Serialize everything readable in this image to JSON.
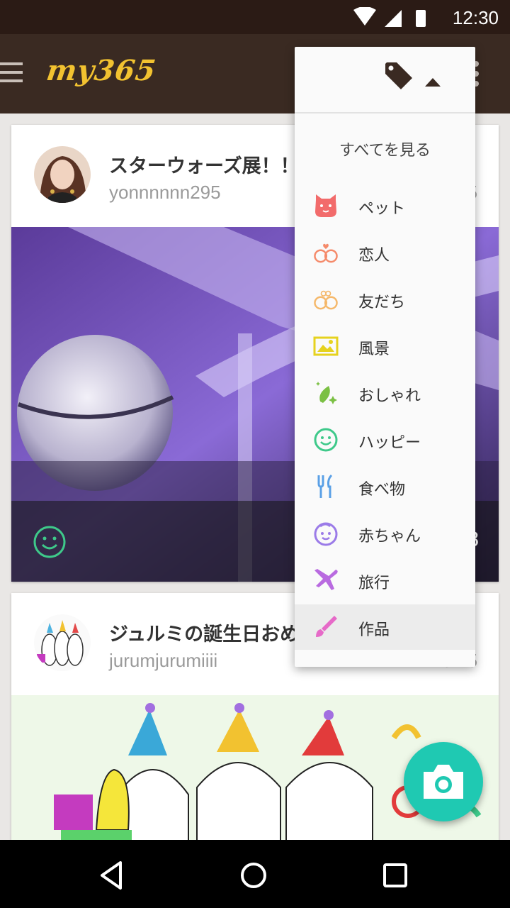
{
  "status_bar": {
    "time": "12:30"
  },
  "app": {
    "logo": "my365"
  },
  "posts": [
    {
      "title": "スターウォーズ展！！！",
      "user": "yonnnnnn295",
      "date": "5",
      "likes": "8",
      "mood_icon": "smile-icon"
    },
    {
      "title": "ジュルミの誕生日おめ",
      "user": "jurumjurumiiii",
      "date": "3/15"
    }
  ],
  "dropdown": {
    "see_all": "すべてを見る",
    "items": [
      {
        "label": "ペット",
        "icon": "cat-icon",
        "color": "#f26b6b"
      },
      {
        "label": "恋人",
        "icon": "couple-icon",
        "color": "#f58a6a"
      },
      {
        "label": "友だち",
        "icon": "friends-icon",
        "color": "#f5b86a"
      },
      {
        "label": "風景",
        "icon": "landscape-icon",
        "color": "#e6d21e"
      },
      {
        "label": "おしゃれ",
        "icon": "sparkle-icon",
        "color": "#7bc043"
      },
      {
        "label": "ハッピー",
        "icon": "smile-icon",
        "color": "#3ec98a"
      },
      {
        "label": "食べ物",
        "icon": "fork-knife-icon",
        "color": "#5aa0e6"
      },
      {
        "label": "赤ちゃん",
        "icon": "baby-icon",
        "color": "#9b7be8"
      },
      {
        "label": "旅行",
        "icon": "airplane-icon",
        "color": "#b96ae0"
      },
      {
        "label": "作品",
        "icon": "brush-icon",
        "color": "#e66ac8"
      }
    ]
  },
  "colors": {
    "accent": "#1fc9b2",
    "appbar": "#3a2a22",
    "logo": "#f2c230"
  }
}
